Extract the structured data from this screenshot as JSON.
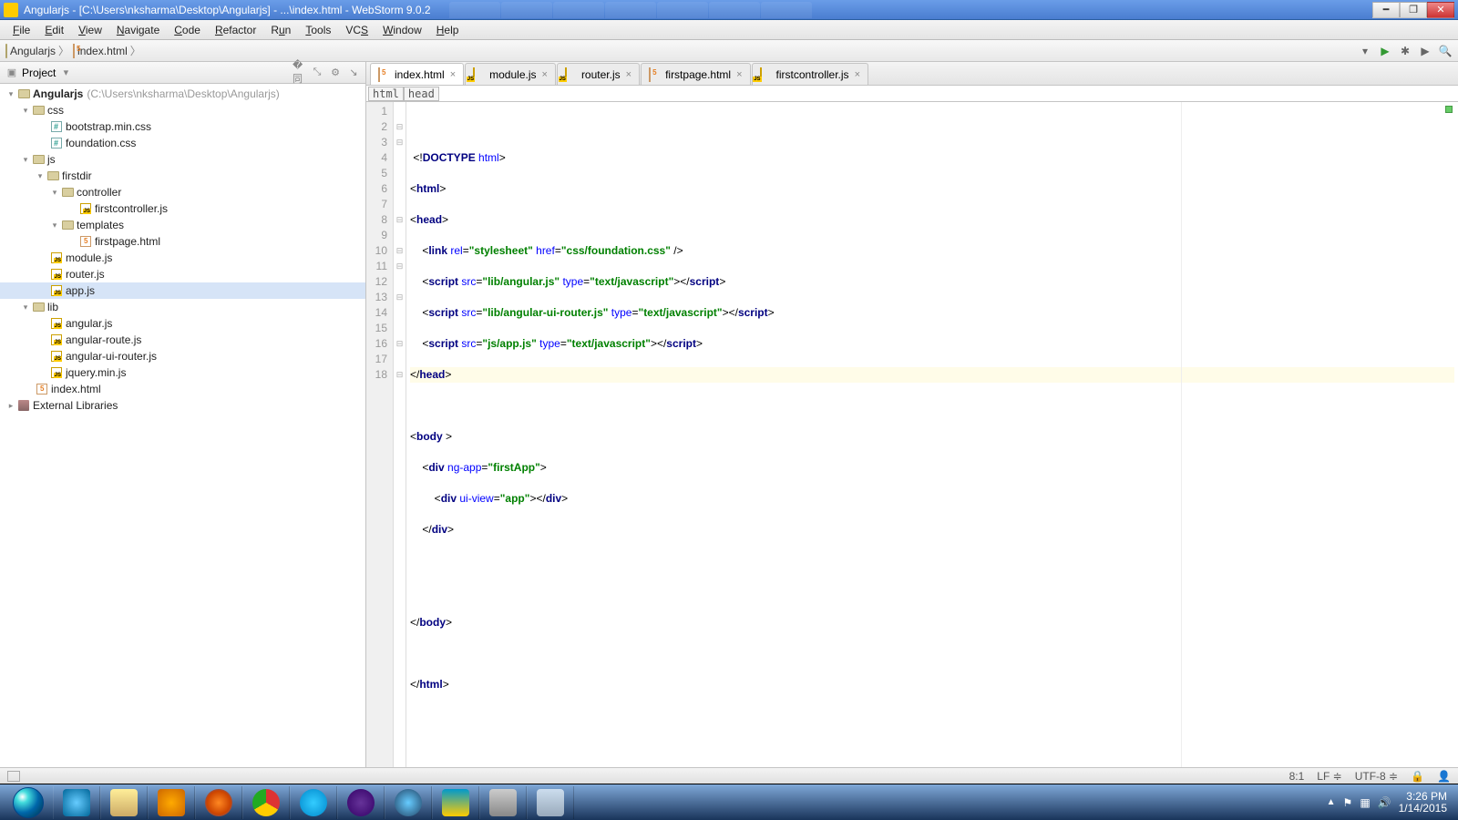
{
  "title": "Angularjs - [C:\\Users\\nksharma\\Desktop\\Angularjs] - ...\\index.html - WebStorm 9.0.2",
  "menu": [
    "File",
    "Edit",
    "View",
    "Navigate",
    "Code",
    "Refactor",
    "Run",
    "Tools",
    "VCS",
    "Window",
    "Help"
  ],
  "nav": {
    "root": "Angularjs",
    "file": "index.html"
  },
  "sidebar": {
    "title": "Project"
  },
  "tree": {
    "root": {
      "name": "Angularjs",
      "path": "(C:\\Users\\nksharma\\Desktop\\Angularjs)"
    },
    "css": {
      "name": "css",
      "children": [
        "bootstrap.min.css",
        "foundation.css"
      ]
    },
    "js": {
      "name": "js",
      "firstdir": {
        "name": "firstdir",
        "controller": {
          "name": "controller",
          "children": [
            "firstcontroller.js"
          ]
        },
        "templates": {
          "name": "templates",
          "children": [
            "firstpage.html"
          ]
        }
      },
      "files": [
        "module.js",
        "router.js",
        "app.js"
      ]
    },
    "lib": {
      "name": "lib",
      "children": [
        "angular.js",
        "angular-route.js",
        "angular-ui-router.js",
        "jquery.min.js"
      ]
    },
    "index": "index.html",
    "ext": "External Libraries"
  },
  "tabs": [
    {
      "name": "index.html",
      "type": "html",
      "active": true
    },
    {
      "name": "module.js",
      "type": "js"
    },
    {
      "name": "router.js",
      "type": "js"
    },
    {
      "name": "firstpage.html",
      "type": "html"
    },
    {
      "name": "firstcontroller.js",
      "type": "js"
    }
  ],
  "breadcrumb_code": [
    "html",
    "head"
  ],
  "code_lines": 18,
  "status": {
    "pos": "8:1",
    "sep": "LF",
    "enc": "UTF-8"
  },
  "clock": {
    "time": "3:26 PM",
    "date": "1/14/2015"
  }
}
